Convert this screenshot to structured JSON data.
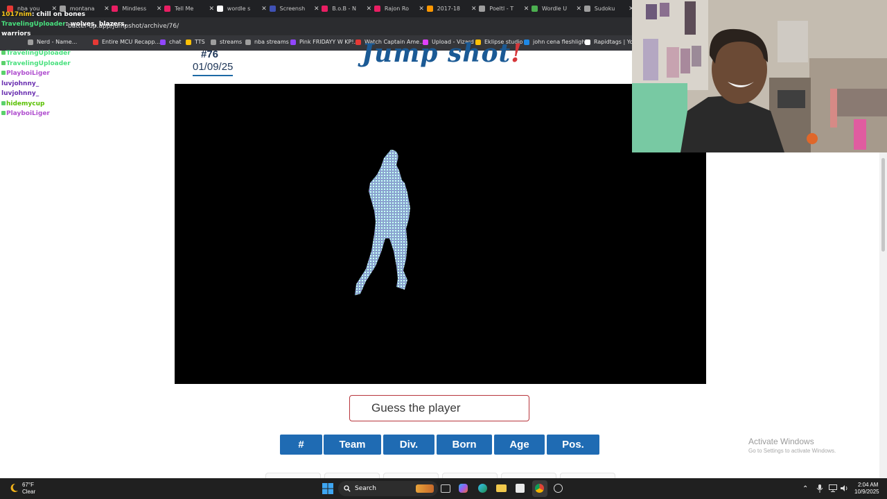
{
  "browser": {
    "tabs": [
      {
        "label": "nba you",
        "color": "#e53935"
      },
      {
        "label": "montana",
        "color": "#9e9e9e"
      },
      {
        "label": "Mindless",
        "color": "#e91e63"
      },
      {
        "label": "Tell Me",
        "color": "#e91e63"
      },
      {
        "label": "wordle s",
        "color": "#ffffff"
      },
      {
        "label": "Screensh",
        "color": "#3f51b5"
      },
      {
        "label": "B.o.B - N",
        "color": "#e91e63"
      },
      {
        "label": "Rajon Ro",
        "color": "#e91e63"
      },
      {
        "label": "2017-18",
        "color": "#ff9800"
      },
      {
        "label": "Poeltl - T",
        "color": "#9e9e9e"
      },
      {
        "label": "Wordle U",
        "color": "#4caf50"
      },
      {
        "label": "Sudoku",
        "color": "#9e9e9e"
      }
    ],
    "url": "batter-up.app/jumpshot/archive/76/",
    "bookmarks": [
      {
        "label": "Nerd - Name...",
        "color": "#9e9e9e"
      },
      {
        "label": "Entire MCU Recapp...",
        "color": "#e53935"
      },
      {
        "label": "chat",
        "color": "#9146ff"
      },
      {
        "label": "TTS",
        "color": "#ffc107"
      },
      {
        "label": "streams",
        "color": "#9e9e9e"
      },
      {
        "label": "nba streams",
        "color": "#9e9e9e"
      },
      {
        "label": "Pink FRIDAYY W KP!...",
        "color": "#9146ff"
      },
      {
        "label": "Watch Captain Ame...",
        "color": "#e53935"
      },
      {
        "label": "Upload - Vizard",
        "color": "#e040fb"
      },
      {
        "label": "Eklipse studio",
        "color": "#ffc107"
      },
      {
        "label": "john cena fleshlight",
        "color": "#1e88e5"
      },
      {
        "label": "Rapidtags | YouT",
        "color": "#ffffff"
      }
    ]
  },
  "chat": {
    "lines": [
      {
        "user": "1017nim",
        "text": ": chill on bones",
        "color": "#f5c518"
      },
      {
        "user": "TravelingUploader",
        "text": ": wolves, blazers,",
        "color": "#48e07d"
      },
      {
        "user": "warriors",
        "text": "",
        "color": "#ffffff"
      },
      {
        "user": "TravelingUploader",
        "text": "",
        "color": "#48e07d"
      },
      {
        "user": "TravelingUploader",
        "text": "",
        "color": "#48e07d"
      },
      {
        "user": "PlayboiLiger",
        "text": "",
        "color": "#b04fcf"
      },
      {
        "user": "luvjohnny_",
        "text": "",
        "color": "#6a2fb0"
      },
      {
        "user": "luvjohnny_",
        "text": "",
        "color": "#6a2fb0"
      },
      {
        "user": "hidemycup",
        "text": "",
        "color": "#59c000"
      },
      {
        "user": "PlayboiLiger",
        "text": "",
        "color": "#b04fcf"
      }
    ]
  },
  "game": {
    "puzzle_number": "#76",
    "date": "01/09/25",
    "logo_text": "Jump shot",
    "logo_bang": "!",
    "guess_placeholder": "Guess the player",
    "columns": [
      "#",
      "Team",
      "Div.",
      "Born",
      "Age",
      "Pos."
    ],
    "colors": {
      "primary": "#1f6bb3",
      "accent": "#b7343b",
      "logo": "#1b5a95",
      "logo_accent": "#d6363a"
    }
  },
  "overlay": {
    "activate_title": "Activate Windows",
    "activate_sub": "Go to Settings to activate Windows."
  },
  "taskbar": {
    "weather_temp": "67°F",
    "weather_desc": "Clear",
    "search_label": "Search",
    "time": "2:04 AM",
    "date": "10/9/2025"
  }
}
